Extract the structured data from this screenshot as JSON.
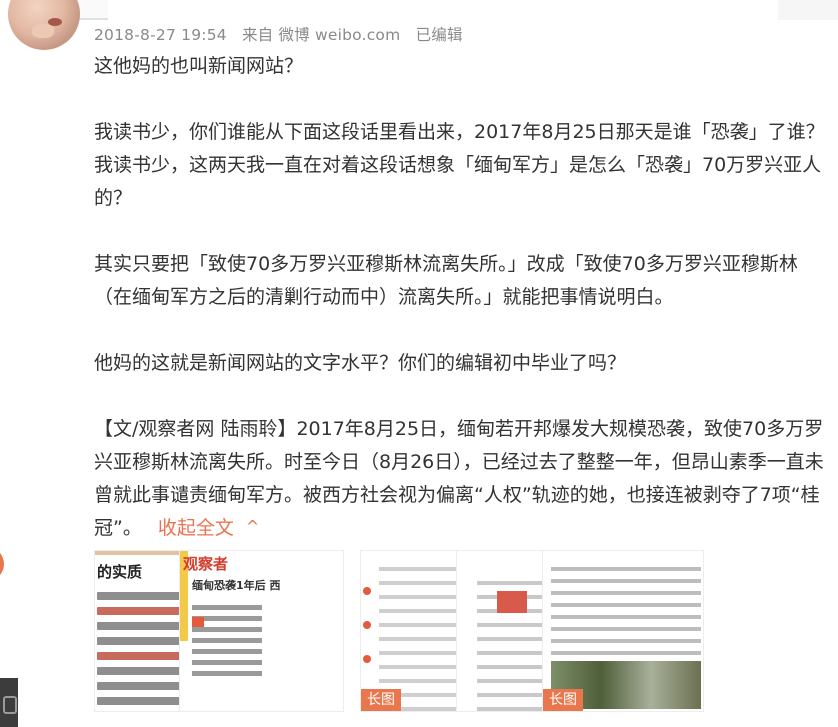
{
  "post": {
    "meta": {
      "time": "2018-8-27 19:54",
      "source": "来自 微博 weibo.com",
      "edited": "已编辑"
    },
    "paragraphs": [
      "这他妈的也叫新闻网站？",
      "我读书少，你们谁能从下面这段话里看出来，2017年8月25日那天是谁「恐袭」了谁？我读书少，这两天我一直在对着这段话想象「缅甸军方」是怎么「恐袭」70万罗兴亚人的？",
      "其实只要把「致使70多万罗兴亚穆斯林流离失所。」改成「致使70多万罗兴亚穆斯林（在缅甸军方之后的清剿行动而中）流离失所。」就能把事情说明白。",
      "他妈的这就是新闻网站的文字水平？你们的编辑初中毕业了吗？",
      "【文/观察者网 陆雨聆】2017年8月25日，缅甸若开邦爆发大规模恐袭，致使70多万罗兴亚穆斯林流离失所。时至今日（8月26日），已经过去了整整一年，但昂山素季一直未曾就此事谴责缅甸军方。被西方社会视为偏离“人权”轨迹的她，也接连被剥夺了7项“桂冠”。"
    ],
    "collapse_label": "收起全文",
    "collapse_icon": "chevron-up-icon"
  },
  "thumbnails": [
    {
      "name": "thumb-1",
      "heading": "的实质",
      "long": ""
    },
    {
      "name": "thumb-2",
      "brand": "观察者",
      "title": "缅甸恐袭1年后 西",
      "long": ""
    },
    {
      "name": "thumb-3",
      "long": "长图"
    },
    {
      "name": "thumb-4",
      "long": ""
    },
    {
      "name": "thumb-5",
      "long": "长图"
    }
  ],
  "colors": {
    "accent": "#eb7350",
    "meta_text": "#8a8a8a",
    "body_text": "#333333"
  }
}
